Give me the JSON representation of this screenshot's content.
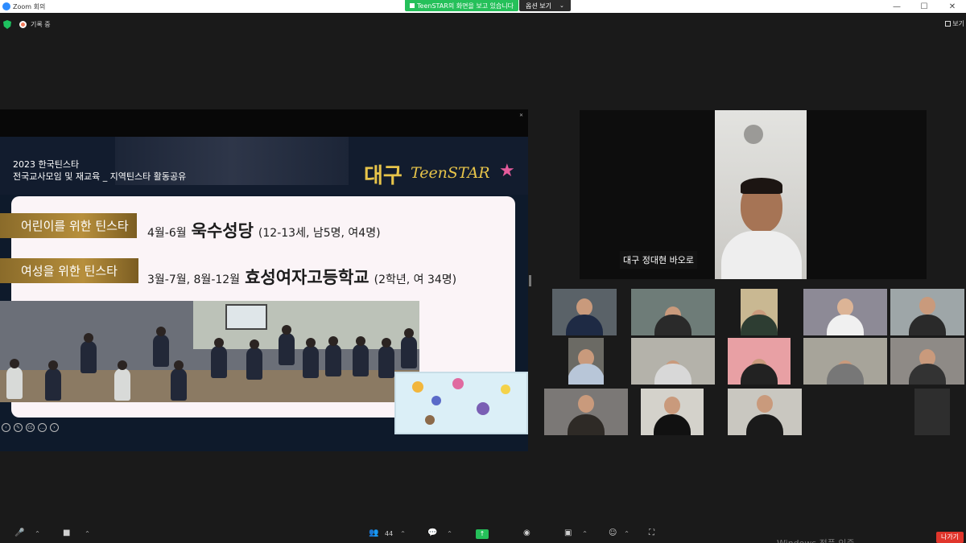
{
  "window": {
    "title": "Zoom 회의",
    "share_banner": "TeenSTAR의 화면을 보고 있습니다",
    "view_options": "옵션 보기",
    "minimize": "—",
    "maximize": "☐",
    "close": "✕"
  },
  "status": {
    "recording_label": "기록 중",
    "view_label": "보기"
  },
  "slide": {
    "title_line1": "2023 한국틴스타",
    "title_line2": "전국교사모임 및 재교육 _ 지역틴스타 활동공유",
    "brand_korean": "대구",
    "brand_logo": "TeenSTAR",
    "row1_label": "어린이를 위한 틴스타",
    "row1_dates": "4월-6월",
    "row1_place": "욱수성당",
    "row1_detail": "(12-13세, 남5명, 여4명)",
    "row2_label": "여성을 위한 틴스타",
    "row2_dates": "3월-7월, 8월-12월",
    "row2_place": "효성여자고등학교",
    "row2_detail": "(2학년, 여 34명)"
  },
  "speaker": {
    "name": "대구 정대현 바오로"
  },
  "gallery": {
    "colors": [
      "#5a6268",
      "#6e7c78",
      "#c9b892",
      "#8d8a96",
      "#9ea6a8",
      "#6b6a64",
      "#b4b2aa",
      "#e8a0a4",
      "#a7a49a",
      "#8e8a86",
      "#7b7876",
      "#d4d2cb",
      "#c9c7c0",
      "#2e2e2e"
    ]
  },
  "toolbar": {
    "participants_count": "44",
    "share_arrow": "↑",
    "leave_label": "나가기",
    "watermark": "Windows 정품 인증"
  }
}
